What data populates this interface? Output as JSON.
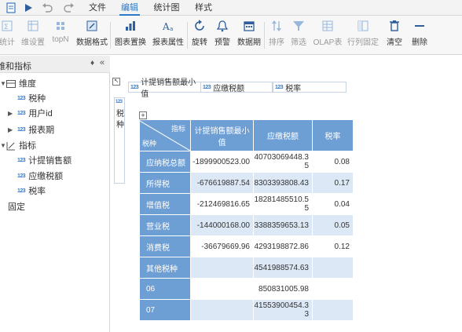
{
  "topbar": {
    "tabs": [
      {
        "label": "文件",
        "active": false
      },
      {
        "label": "编辑",
        "active": true
      },
      {
        "label": "统计图",
        "active": false
      },
      {
        "label": "样式",
        "active": false
      }
    ]
  },
  "ribbon": {
    "buttons": [
      {
        "label": "统计",
        "icon": "stats-icon",
        "dim": true
      },
      {
        "label": "维设置",
        "icon": "dimension-settings-icon",
        "dim": true
      },
      {
        "label": "topN",
        "icon": "topn-icon",
        "dim": true
      },
      {
        "label": "数据格式",
        "icon": "data-format-icon",
        "dim": false
      },
      {
        "label": "图表置换",
        "icon": "chart-swap-icon",
        "dim": false
      },
      {
        "label": "报表属性",
        "icon": "report-properties-icon",
        "dim": false
      },
      {
        "label": "旋转",
        "icon": "rotate-icon",
        "dim": false
      },
      {
        "label": "预警",
        "icon": "alert-icon",
        "dim": false
      },
      {
        "label": "数据期",
        "icon": "data-period-icon",
        "dim": false
      },
      {
        "label": "排序",
        "icon": "sort-icon",
        "dim": true
      },
      {
        "label": "筛选",
        "icon": "filter-icon",
        "dim": true
      },
      {
        "label": "OLAP表",
        "icon": "olap-table-icon",
        "dim": true
      },
      {
        "label": "行列固定",
        "icon": "freeze-icon",
        "dim": true
      },
      {
        "label": "清空",
        "icon": "clear-icon",
        "dim": false
      },
      {
        "label": "删除",
        "icon": "delete-icon",
        "dim": false
      }
    ]
  },
  "left_panel": {
    "title": "维和指标",
    "pin_glyph": "♦",
    "collapse_glyph": "«",
    "tree": [
      {
        "label": "维度",
        "kind": "group"
      },
      {
        "label": "税种",
        "kind": "field"
      },
      {
        "label": "用户id",
        "kind": "field"
      },
      {
        "label": "报表期",
        "kind": "field"
      },
      {
        "label": "指标",
        "kind": "group"
      },
      {
        "label": "计提销售额",
        "kind": "field"
      },
      {
        "label": "应缴税额",
        "kind": "field"
      },
      {
        "label": "税率",
        "kind": "field"
      },
      {
        "label": "固定",
        "kind": "plain"
      }
    ],
    "num_badge": "123"
  },
  "main": {
    "column_fields": [
      "计提销售额最小值",
      "应缴税额",
      "税率"
    ],
    "row_zone": {
      "badge": "123",
      "text": "税种"
    },
    "corner_glyph": "↖",
    "plus_glyph": "+",
    "table": {
      "corner_top": "指标",
      "corner_bottom": "税种",
      "headers": [
        "计提销售额最小值",
        "应缴税额",
        "税率"
      ],
      "rows": [
        {
          "label": "应纳税总额",
          "values": [
            "-1899900523.00",
            "40703069448.35",
            "0.08"
          ]
        },
        {
          "label": "所得税",
          "values": [
            "-676619887.54",
            "8303393808.43",
            "0.17"
          ]
        },
        {
          "label": "增值税",
          "values": [
            "-212469816.65",
            "18281485510.55",
            "0.04"
          ]
        },
        {
          "label": "营业税",
          "values": [
            "-144000168.00",
            "3388359653.13",
            "0.05"
          ]
        },
        {
          "label": "消费税",
          "values": [
            "-36679669.96",
            "4293198872.86",
            "0.12"
          ]
        },
        {
          "label": "其他税种",
          "values": [
            "",
            "4541988574.63",
            ""
          ]
        },
        {
          "label": "06",
          "values": [
            "",
            "850831005.98",
            ""
          ]
        },
        {
          "label": "07",
          "values": [
            "",
            "41553900454.33",
            ""
          ]
        }
      ]
    }
  },
  "colors": {
    "accent": "#2a7ac8",
    "header_blue": "#6d9ed4",
    "row_light": "#dce8f6"
  }
}
